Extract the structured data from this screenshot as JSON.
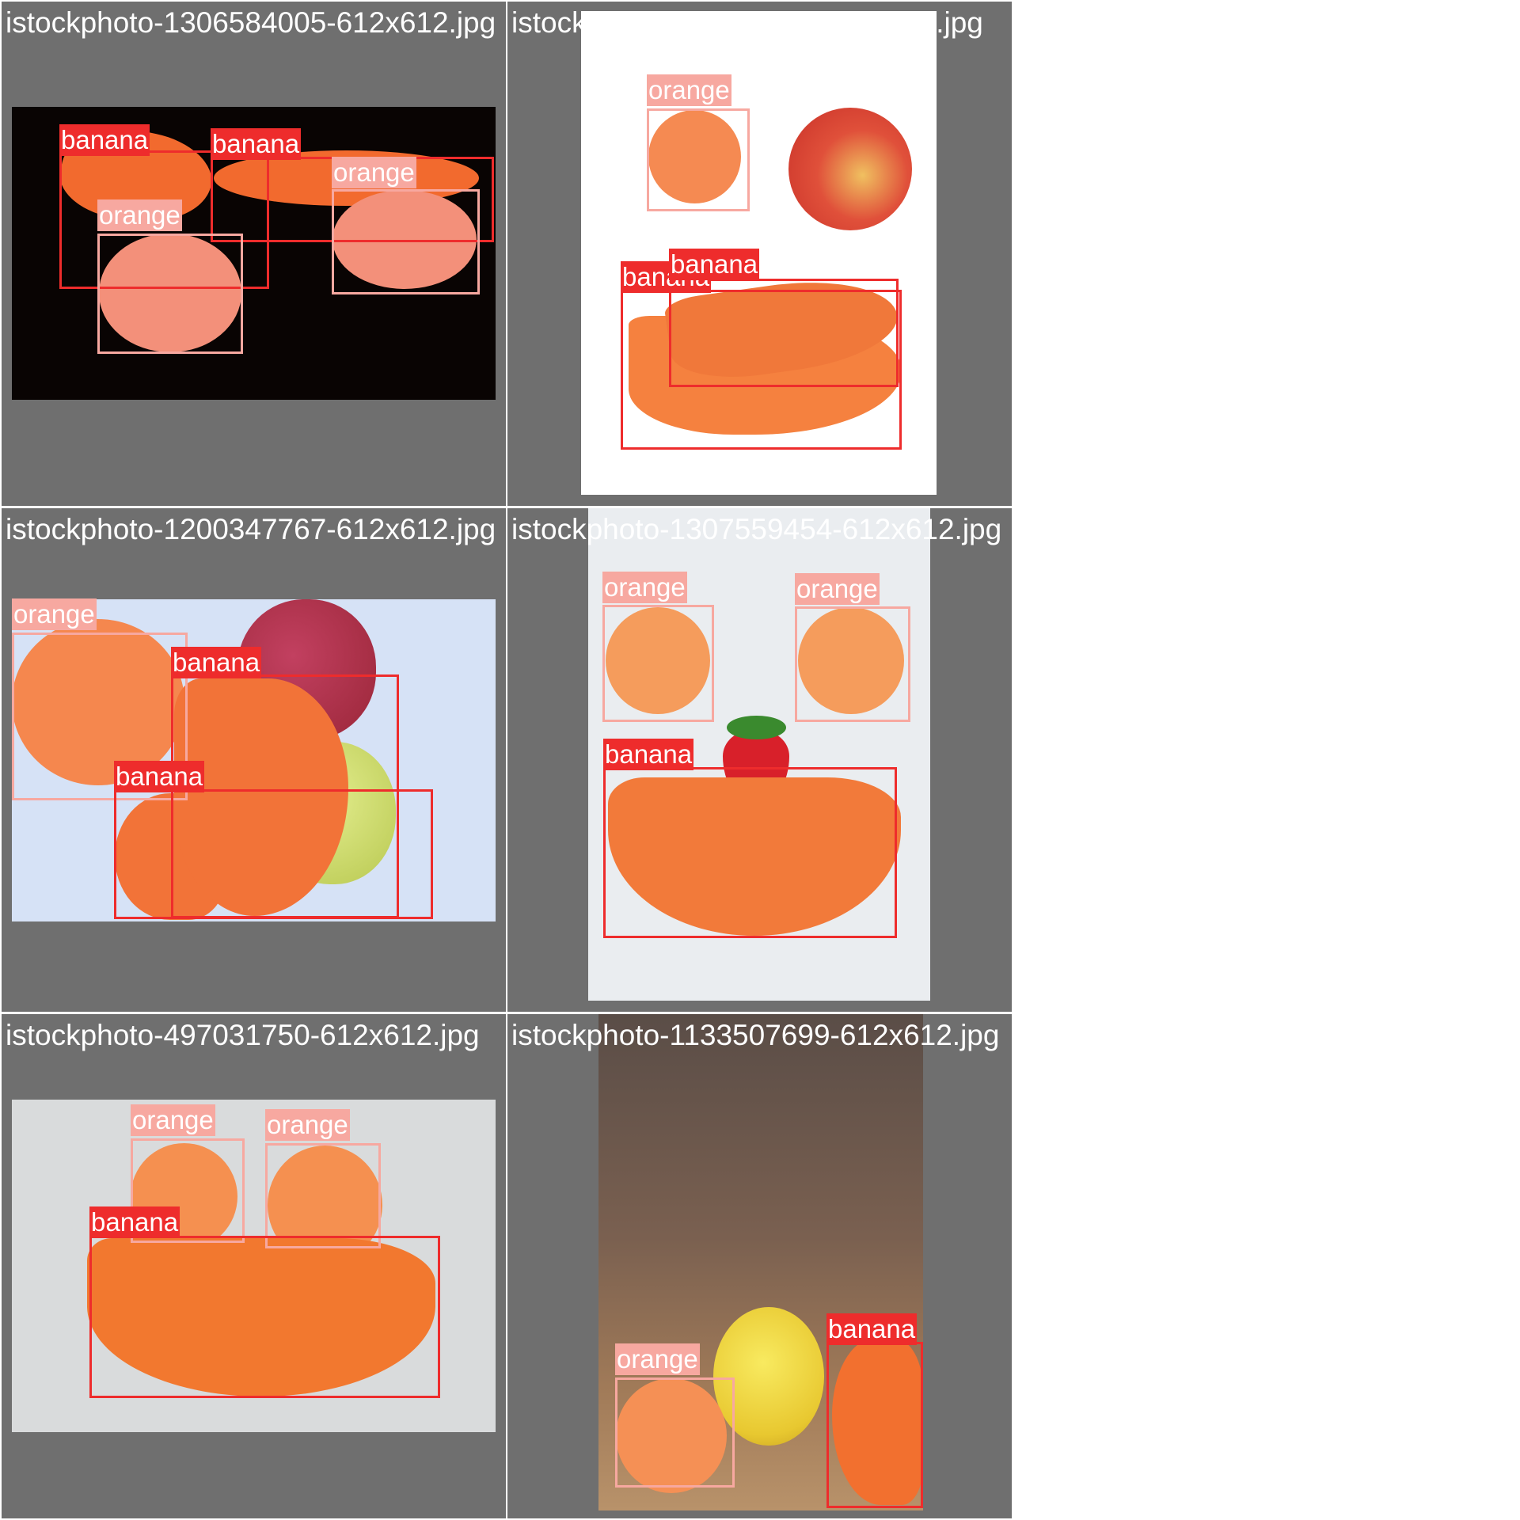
{
  "colors": {
    "banana": "#ee2c2c",
    "orange": "#f7a8a0",
    "tile_background": "#6f6f6f"
  },
  "tiles": [
    {
      "file": "istockphoto-1306584005-612x612.jpg",
      "detections": [
        {
          "class": "banana"
        },
        {
          "class": "banana"
        },
        {
          "class": "orange"
        },
        {
          "class": "orange"
        }
      ]
    },
    {
      "file": "istockphoto-118368626-612x612.jpg",
      "detections": [
        {
          "class": "orange"
        },
        {
          "class": "banana"
        },
        {
          "class": "banana"
        }
      ]
    },
    {
      "file": "istockphoto-1200347767-612x612.jpg",
      "detections": [
        {
          "class": "orange"
        },
        {
          "class": "banana"
        },
        {
          "class": "banana"
        }
      ]
    },
    {
      "file": "istockphoto-1307559454-612x612.jpg",
      "detections": [
        {
          "class": "orange"
        },
        {
          "class": "orange"
        },
        {
          "class": "banana"
        }
      ]
    },
    {
      "file": "istockphoto-497031750-612x612.jpg",
      "detections": [
        {
          "class": "orange"
        },
        {
          "class": "orange"
        },
        {
          "class": "banana"
        }
      ]
    },
    {
      "file": "istockphoto-1133507699-612x612.jpg",
      "detections": [
        {
          "class": "banana"
        },
        {
          "class": "orange"
        }
      ]
    }
  ]
}
